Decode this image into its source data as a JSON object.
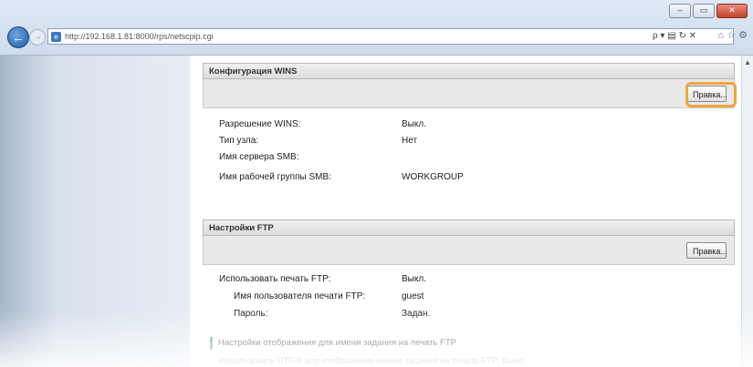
{
  "browser": {
    "url": "http://192.168.1.81:8000/rps/netscpip.cgi",
    "address_tools": "ρ ▾ ▤ ↻ ✕",
    "window_buttons": {
      "minimize": "–",
      "maximize": "▭",
      "close": "✕"
    },
    "nav_icons": "⌂ ☆ ⚙"
  },
  "wins": {
    "title": "Конфигурация WINS",
    "edit_label": "Правка...",
    "rows": [
      {
        "label": "Разрешение WINS:",
        "value": "Выкл."
      },
      {
        "label": "Тип узла:",
        "value": "Нет"
      },
      {
        "label": "Имя сервера SMB:",
        "value": ""
      },
      {
        "label": "Имя рабочей группы SMB:",
        "value": "WORKGROUP"
      }
    ]
  },
  "ftp": {
    "title": "Настройки FTP",
    "edit_label": "Правка...",
    "rows": [
      {
        "label": "Использовать печать FTP:",
        "value": "Выкл."
      },
      {
        "label": "Имя пользователя печати FTP:",
        "value": "guest"
      },
      {
        "label": "Пароль:",
        "value": "Задан."
      }
    ],
    "sub_section": "Настройки отображения для имени задания на печать FTP",
    "faded_row": "Использовать UTF-8 для отображения имени задания на печать FTP:   Выкл."
  },
  "colors": {
    "highlight": "#f1a53a",
    "accent": "#1e5ea8"
  }
}
